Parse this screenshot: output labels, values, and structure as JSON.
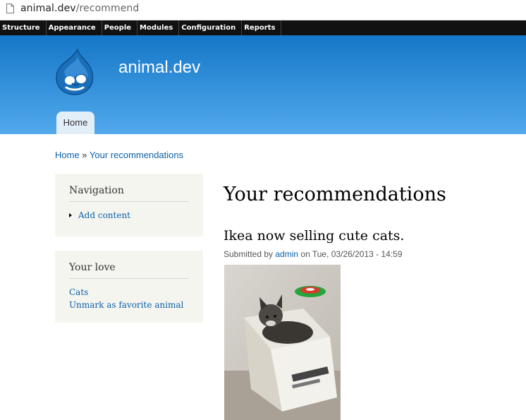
{
  "browser": {
    "url_host": "animal.dev",
    "url_path": "/recommend"
  },
  "toolbar": {
    "items": [
      "Structure",
      "Appearance",
      "People",
      "Modules",
      "Configuration",
      "Reports"
    ]
  },
  "header": {
    "site_name": "animal.dev",
    "tab_home": "Home"
  },
  "breadcrumb": {
    "home": "Home",
    "separator": " » ",
    "current": "Your recommendations"
  },
  "sidebar": {
    "navigation": {
      "title": "Navigation",
      "link": "Add content"
    },
    "love": {
      "title": "Your love",
      "links": [
        "Cats",
        "Unmark as favorite animal"
      ]
    }
  },
  "main": {
    "page_title": "Your recommendations",
    "node_title": "Ikea now selling cute cats.",
    "submitted_prefix": "Submitted by ",
    "author": "admin",
    "submitted_suffix": " on Tue, 03/26/2013 - 14:59"
  },
  "icons": {
    "page": "page-icon",
    "logo": "drupal-logo-icon"
  },
  "colors": {
    "header_top": "#1577c8",
    "header_bottom": "#52a9ec",
    "link": "#0b61aa",
    "toolbar": "#111111"
  }
}
